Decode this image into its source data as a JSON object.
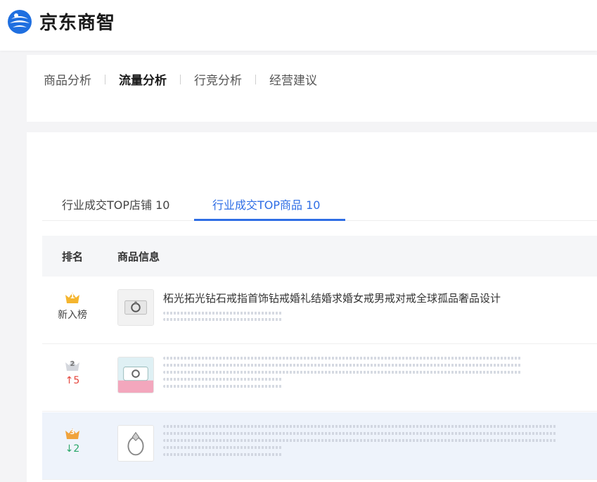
{
  "brand": {
    "name": "京东商智"
  },
  "nav": {
    "items": [
      {
        "label": "商品分析",
        "active": false
      },
      {
        "label": "流量分析",
        "active": true
      },
      {
        "label": "行竞分析",
        "active": false
      },
      {
        "label": "经营建议",
        "active": false
      }
    ]
  },
  "tabs": [
    {
      "label": "行业成交TOP店铺 10",
      "active": false
    },
    {
      "label": "行业成交TOP商品 10",
      "active": true
    }
  ],
  "table": {
    "headers": {
      "rank": "排名",
      "info": "商品信息"
    },
    "rows": [
      {
        "rank": "1",
        "change": "新入榜",
        "change_type": "new",
        "title": "柘光拓光钻石戒指首饰钻戒婚礼结婚求婚女戒男戒对戒全球孤品奢品设计",
        "thumb_icon": "ring-box-icon",
        "crown_color": "#f5b52e"
      },
      {
        "rank": "2",
        "change": "↑5",
        "change_type": "up",
        "title": "",
        "thumb_icon": "jewelry-box-icon",
        "crown_color": "#c9ccd3"
      },
      {
        "rank": "3",
        "change": "↓2",
        "change_type": "down",
        "title": "",
        "thumb_icon": "ring-icon",
        "crown_color": "#f0a33c"
      }
    ]
  },
  "colors": {
    "accent": "#2f6ee5",
    "up": "#e5443b",
    "down": "#2aa76a",
    "gold": "#f5b52e"
  }
}
